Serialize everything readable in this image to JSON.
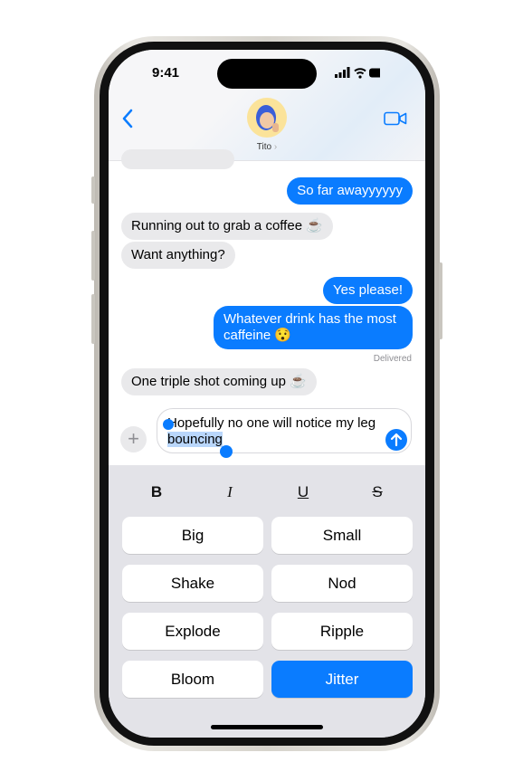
{
  "status_bar": {
    "time": "9:41"
  },
  "header": {
    "contact_name": "Tito",
    "back_icon": "chevron-left-icon",
    "video_icon": "video-camera-icon"
  },
  "messages": [
    {
      "direction": "in",
      "text": "...",
      "partial": true
    },
    {
      "direction": "out",
      "text": "So far awayyyyyy"
    },
    {
      "direction": "in",
      "text": "Running out to grab a coffee ☕"
    },
    {
      "direction": "in",
      "text": "Want anything?"
    },
    {
      "direction": "out",
      "text": "Yes please!"
    },
    {
      "direction": "out",
      "text": "Whatever drink has the most caffeine 😯"
    },
    {
      "direction": "in",
      "text": "One triple shot coming up ☕"
    }
  ],
  "delivered_label": "Delivered",
  "composer": {
    "text_before": "Hopefully no one will notice my leg ",
    "selected_text": "bouncing"
  },
  "format_bar": {
    "bold": "B",
    "italic": "I",
    "underline": "U",
    "strikethrough": "S"
  },
  "effects": [
    {
      "label": "Big",
      "selected": false
    },
    {
      "label": "Small",
      "selected": false
    },
    {
      "label": "Shake",
      "selected": false
    },
    {
      "label": "Nod",
      "selected": false
    },
    {
      "label": "Explode",
      "selected": false
    },
    {
      "label": "Ripple",
      "selected": false
    },
    {
      "label": "Bloom",
      "selected": false
    },
    {
      "label": "Jitter",
      "selected": true
    }
  ],
  "colors": {
    "accent": "#0a7cff",
    "incoming": "#e9e9eb",
    "keyboard": "#e3e3e8"
  }
}
